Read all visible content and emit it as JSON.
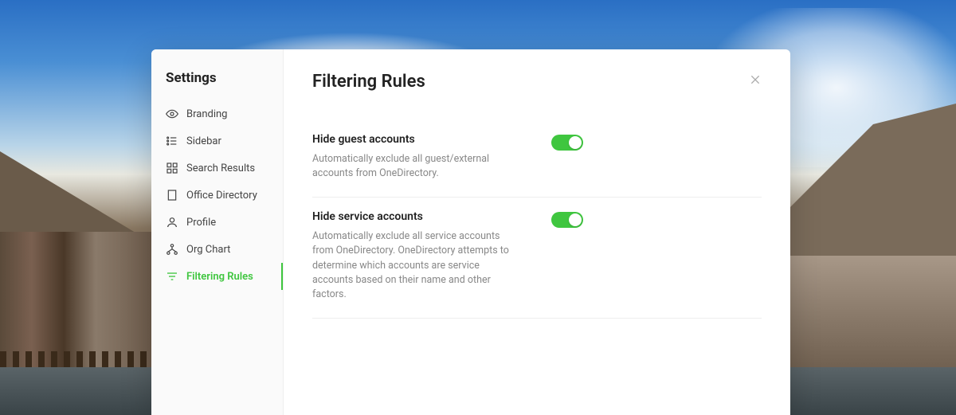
{
  "sidebar": {
    "title": "Settings",
    "items": [
      {
        "label": "Branding",
        "icon": "eye-icon"
      },
      {
        "label": "Sidebar",
        "icon": "sidebar-icon"
      },
      {
        "label": "Search Results",
        "icon": "grid-icon"
      },
      {
        "label": "Office Directory",
        "icon": "building-icon"
      },
      {
        "label": "Profile",
        "icon": "person-icon"
      },
      {
        "label": "Org Chart",
        "icon": "orgchart-icon"
      },
      {
        "label": "Filtering Rules",
        "icon": "filter-icon",
        "active": true
      }
    ]
  },
  "page": {
    "title": "Filtering Rules"
  },
  "settings": [
    {
      "title": "Hide guest accounts",
      "description": "Automatically exclude all guest/external accounts from OneDirectory.",
      "enabled": true
    },
    {
      "title": "Hide service accounts",
      "description": "Automatically exclude all service accounts from OneDirectory. OneDirectory attempts to determine which accounts are service accounts based on their name and other factors.",
      "enabled": true
    }
  ],
  "colors": {
    "accent": "#3fc63f"
  }
}
